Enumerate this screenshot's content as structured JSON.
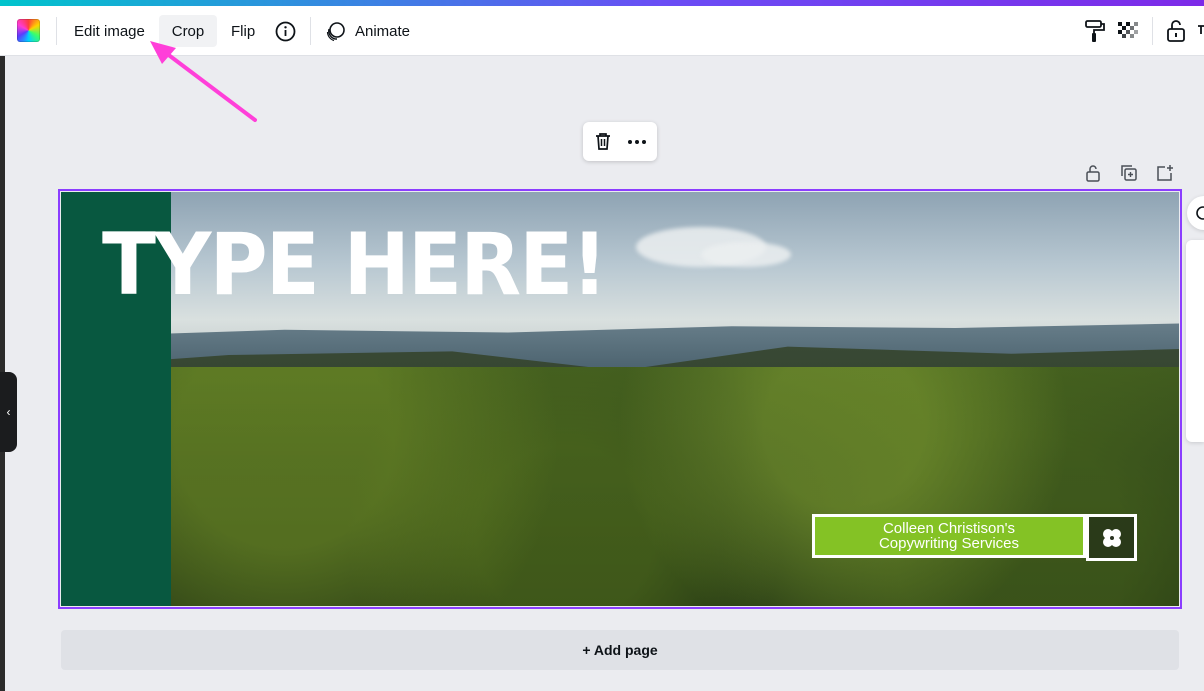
{
  "toolbar": {
    "edit_image_label": "Edit image",
    "crop_label": "Crop",
    "flip_label": "Flip",
    "animate_label": "Animate",
    "icons": [
      "color-swatch-icon",
      "info-icon",
      "animate-icon",
      "paint-roller-icon",
      "transparency-icon",
      "lock-icon"
    ]
  },
  "context_menu": {
    "icons": [
      "trash-icon",
      "more-icon"
    ]
  },
  "page_actions": {
    "icons": [
      "lock-icon",
      "duplicate-page-icon",
      "add-page-icon"
    ]
  },
  "design": {
    "headline": "TYPE HERE!",
    "badge_line1": "Colleen Christison's",
    "badge_line2": "Copywriting Services",
    "band_color": "#085840",
    "badge_color": "#84c225",
    "selection_color": "#8b3dff"
  },
  "annotation": {
    "arrow_color": "#ff3fd9"
  },
  "footer": {
    "add_page_label": "+ Add page"
  }
}
